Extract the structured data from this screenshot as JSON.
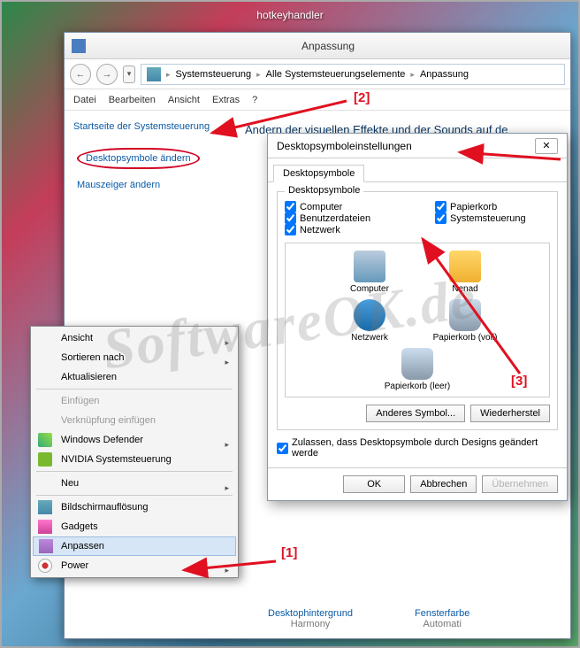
{
  "floating_title": "hotkeyhandler",
  "window": {
    "title": "Anpassung",
    "breadcrumb": [
      "Systemsteuerung",
      "Alle Systemsteuerungselemente",
      "Anpassung"
    ],
    "menus": [
      "Datei",
      "Bearbeiten",
      "Ansicht",
      "Extras",
      "?"
    ]
  },
  "sidebar": {
    "home": "Startseite der Systemsteuerung",
    "links": [
      "Desktopsymbole ändern",
      "Mauszeiger ändern"
    ]
  },
  "content": {
    "heading": "Ändern der visuellen Effekte und der Sounds auf de",
    "bottom": [
      {
        "a": "Desktophintergrund",
        "b": "Harmony"
      },
      {
        "a": "Fensterfarbe",
        "b": "Automati"
      }
    ]
  },
  "dialog": {
    "title": "Desktopsymboleinstellungen",
    "tab": "Desktopsymbole",
    "group_legend": "Desktopsymbole",
    "checks_left": [
      "Computer",
      "Benutzerdateien",
      "Netzwerk"
    ],
    "checks_right": [
      "Papierkorb",
      "Systemsteuerung"
    ],
    "icons": [
      "Computer",
      "Nenad",
      "Netzwerk",
      "Papierkorb (voll)",
      "Papierkorb (leer)"
    ],
    "btn_other": "Anderes Symbol...",
    "btn_restore": "Wiederherstel",
    "allow": "Zulassen, dass Desktopsymbole durch Designs geändert werde",
    "ok": "OK",
    "cancel": "Abbrechen",
    "apply": "Übernehmen"
  },
  "context_menu": {
    "items": [
      {
        "label": "Ansicht",
        "sub": true
      },
      {
        "label": "Sortieren nach",
        "sub": true
      },
      {
        "label": "Aktualisieren"
      },
      {
        "sep": true
      },
      {
        "label": "Einfügen",
        "disabled": true
      },
      {
        "label": "Verknüpfung einfügen",
        "disabled": true
      },
      {
        "label": "Windows Defender",
        "sub": true,
        "icon": "shield"
      },
      {
        "label": "NVIDIA Systemsteuerung",
        "icon": "nv"
      },
      {
        "sep": true
      },
      {
        "label": "Neu",
        "sub": true
      },
      {
        "sep": true
      },
      {
        "label": "Bildschirmauflösung",
        "icon": "scr"
      },
      {
        "label": "Gadgets",
        "icon": "gd"
      },
      {
        "label": "Anpassen",
        "icon": "pers",
        "selected": true
      },
      {
        "label": "Power",
        "sub": true,
        "icon": "pw"
      }
    ]
  },
  "annotations": {
    "a1": "[1]",
    "a2": "[2]",
    "a3": "[3]"
  },
  "watermark": "SoftwareOK.de"
}
